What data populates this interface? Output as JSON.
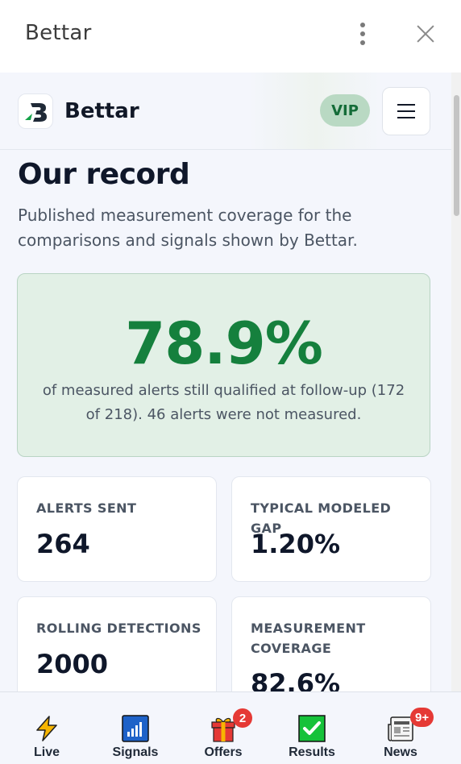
{
  "window": {
    "title": "Bettar"
  },
  "app": {
    "brand": "Bettar",
    "vip_label": "VIP"
  },
  "page": {
    "title": "Our record",
    "subtitle": "Published measurement coverage for the comparisons and signals shown by Bettar."
  },
  "hero": {
    "value": "78.9%",
    "caption": "of measured alerts still qualified at follow-up (172 of 218). 46 alerts were not measured."
  },
  "stats": [
    {
      "label": "ALERTS SENT",
      "value": "264"
    },
    {
      "label": "TYPICAL MODELED GAP",
      "value": "1.20%"
    },
    {
      "label": "ROLLING DETECTIONS",
      "value": "2000"
    },
    {
      "label": "MEASUREMENT COVERAGE",
      "value": "82.6%"
    }
  ],
  "nav": [
    {
      "label": "Live",
      "icon": "lightning-icon"
    },
    {
      "label": "Signals",
      "icon": "signal-bars-icon"
    },
    {
      "label": "Offers",
      "icon": "gift-icon",
      "badge": "2"
    },
    {
      "label": "Results",
      "icon": "checkmark-icon"
    },
    {
      "label": "News",
      "icon": "newspaper-icon",
      "badge": "9+"
    }
  ],
  "colors": {
    "accent_green": "#15803d",
    "hero_bg": "#e2f0e6",
    "vip_bg": "#b9d9c3",
    "badge_red": "#e53935"
  }
}
